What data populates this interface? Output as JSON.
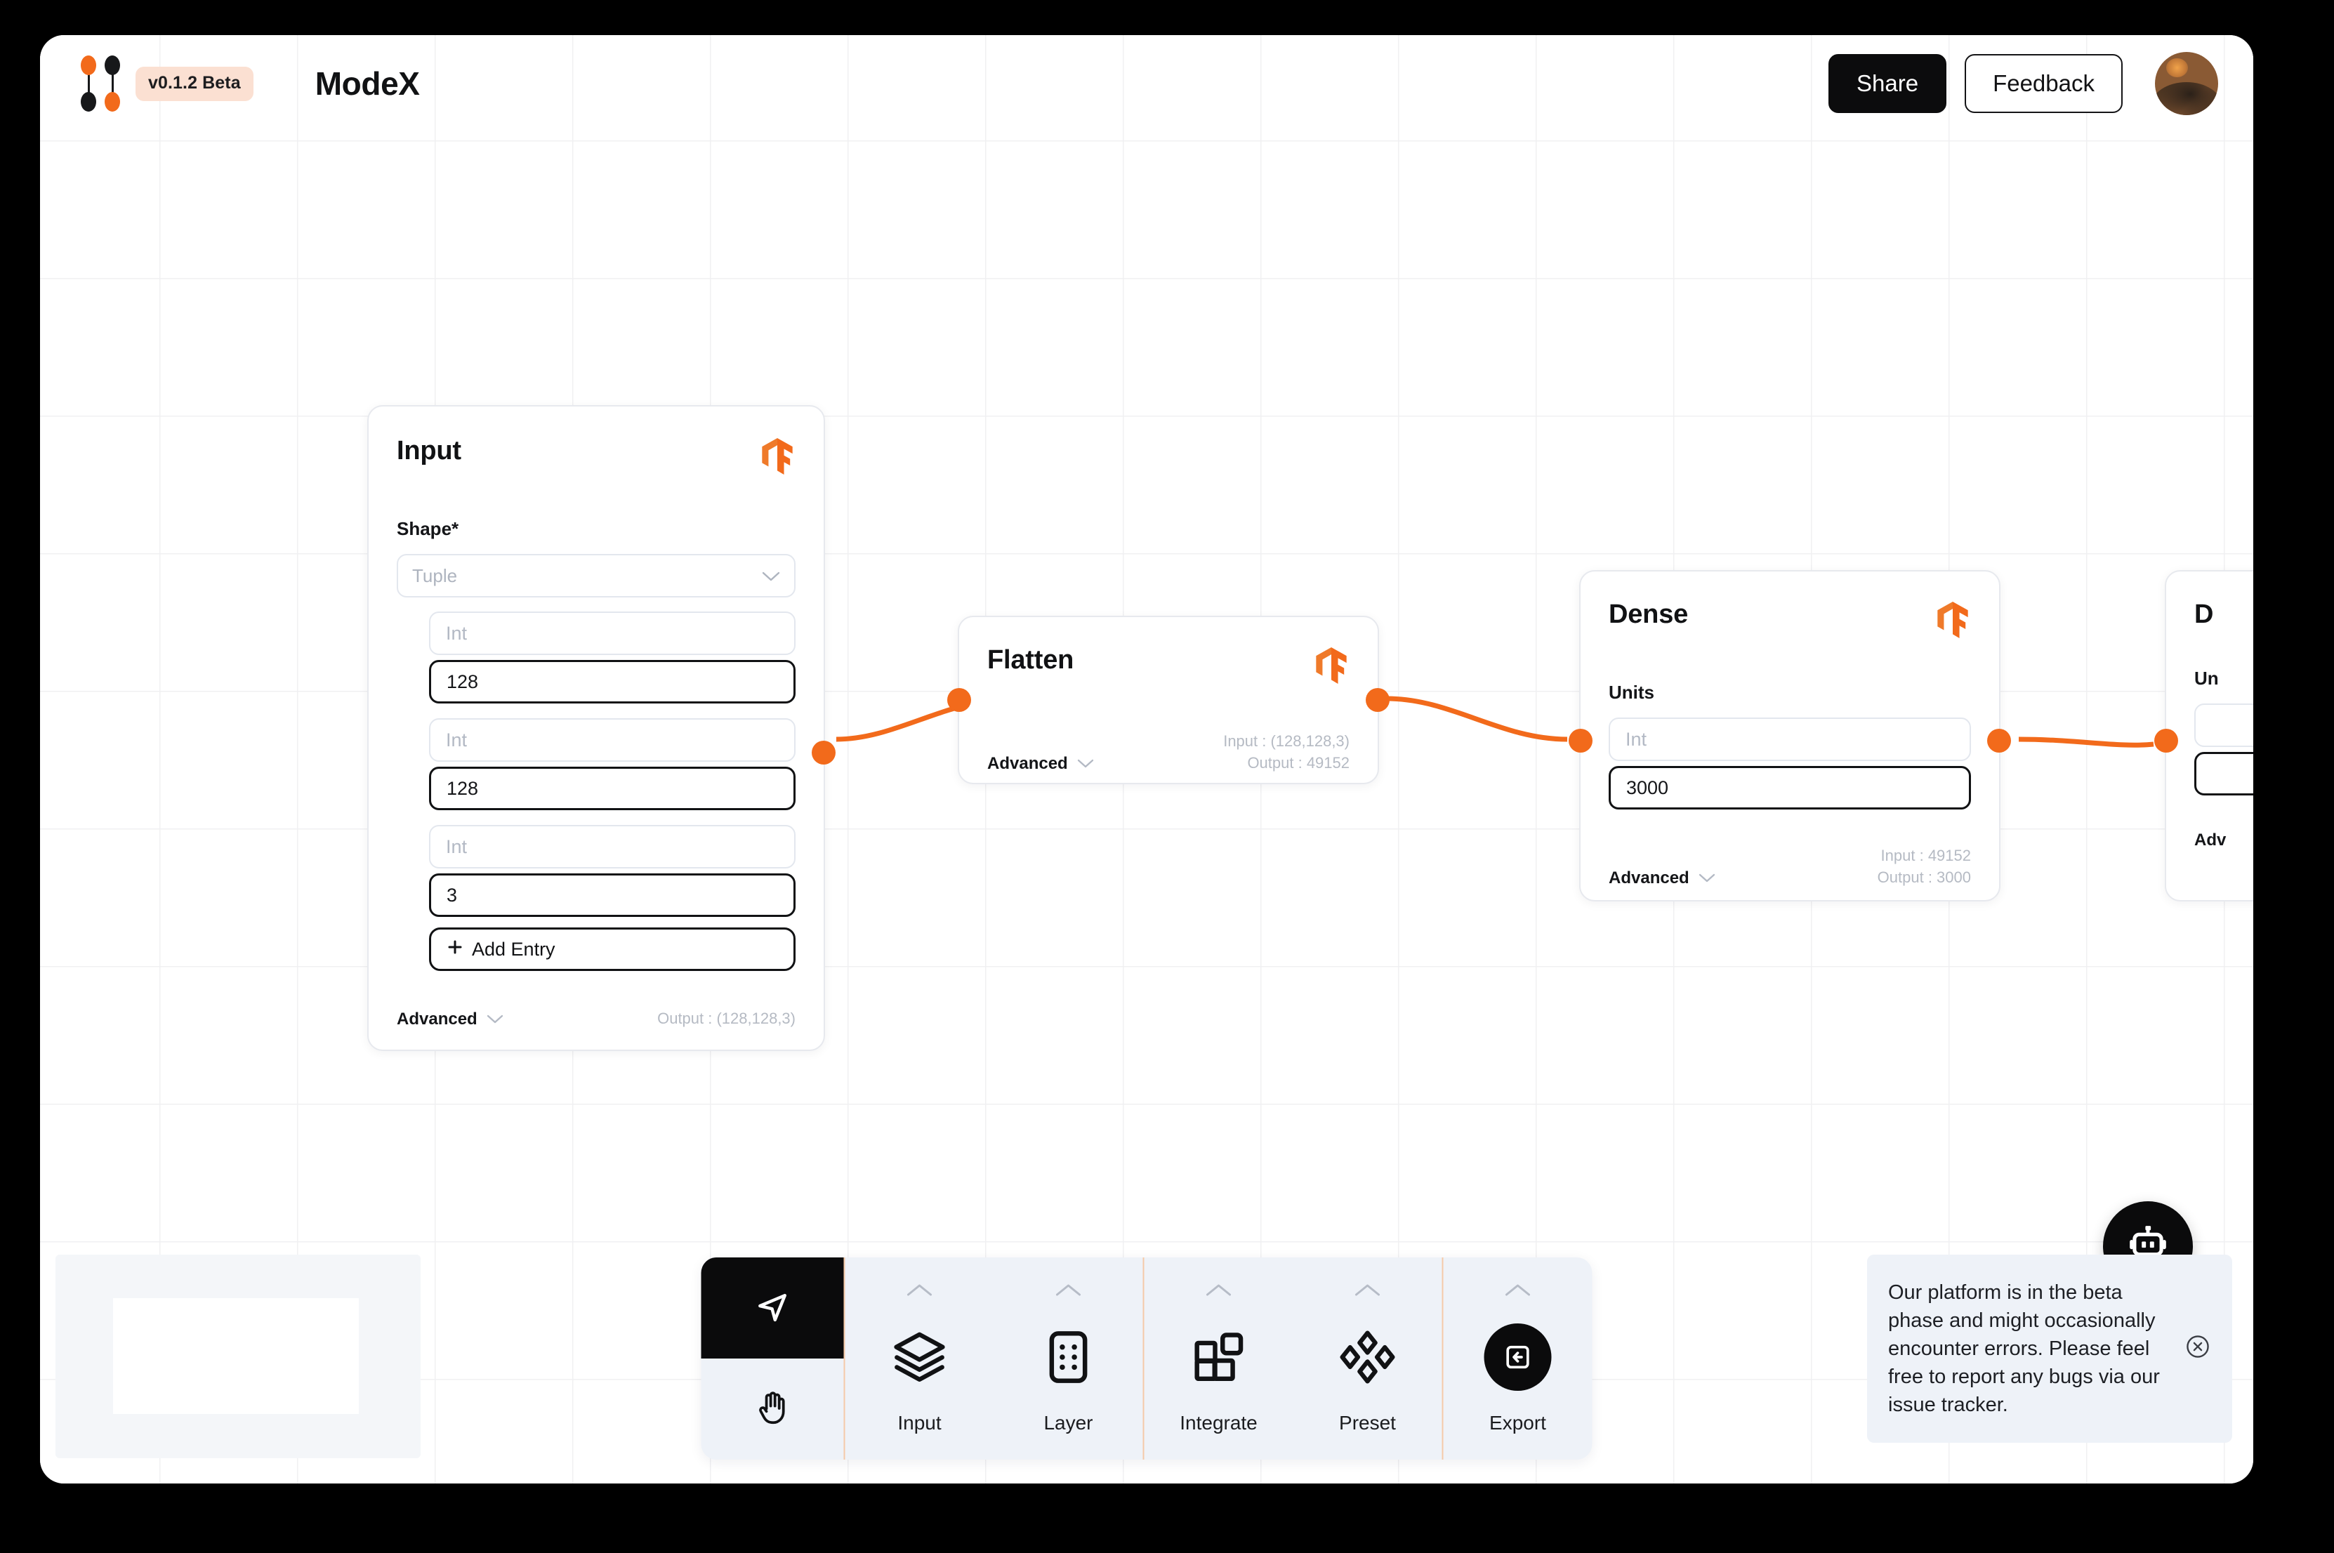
{
  "header": {
    "version_badge": "v0.1.2 Beta",
    "title": "ModeX",
    "share_label": "Share",
    "feedback_label": "Feedback",
    "logo_colors": {
      "orange": "#f26a1b",
      "black": "#17181a"
    },
    "badge_bg": "#fbe0d2"
  },
  "canvas": {
    "accent": "#f26a1b",
    "grid_color": "#f0f0f2"
  },
  "nodes": [
    {
      "id": "input",
      "title": "Input",
      "field_label": "Shape*",
      "select_placeholder": "Tuple",
      "entries": [
        {
          "placeholder": "Int",
          "value": "128"
        },
        {
          "placeholder": "Int",
          "value": "128"
        },
        {
          "placeholder": "Int",
          "value": "3"
        }
      ],
      "add_entry_label": "Add Entry",
      "advanced_label": "Advanced",
      "output_label": "Output : (128,128,3)"
    },
    {
      "id": "flatten",
      "title": "Flatten",
      "advanced_label": "Advanced",
      "input_label": "Input : (128,128,3)",
      "output_label": "Output : 49152"
    },
    {
      "id": "dense",
      "title": "Dense",
      "field_label": "Units",
      "entry_placeholder": "Int",
      "entry_value": "3000",
      "advanced_label": "Advanced",
      "input_label": "Input : 49152",
      "output_label": "Output : 3000"
    },
    {
      "id": "dense-2",
      "title": "D",
      "field_label": "Un",
      "advanced_label": "Adv"
    }
  ],
  "toolbar": {
    "modes": [
      {
        "name": "cursor",
        "icon": "cursor-icon",
        "active": true
      },
      {
        "name": "hand",
        "icon": "hand-icon",
        "active": false
      }
    ],
    "items": [
      {
        "label": "Input",
        "icon": "layers-icon"
      },
      {
        "label": "Layer",
        "icon": "layer-grid-icon"
      },
      {
        "label": "Integrate",
        "icon": "blocks-icon"
      },
      {
        "label": "Preset",
        "icon": "diamonds-icon"
      },
      {
        "label": "Export",
        "icon": "export-icon"
      }
    ],
    "bg": "#eef2f8",
    "divider": "#f5c9a8"
  },
  "bot_button": {
    "icon": "robot-icon"
  },
  "toast": {
    "message": "Our platform is in the beta phase and might occasionally encounter errors. Please feel free to report any bugs via our issue tracker.",
    "close_icon": "close-circle-icon",
    "bg": "#eef2f8"
  },
  "minimap": {
    "present": true
  }
}
